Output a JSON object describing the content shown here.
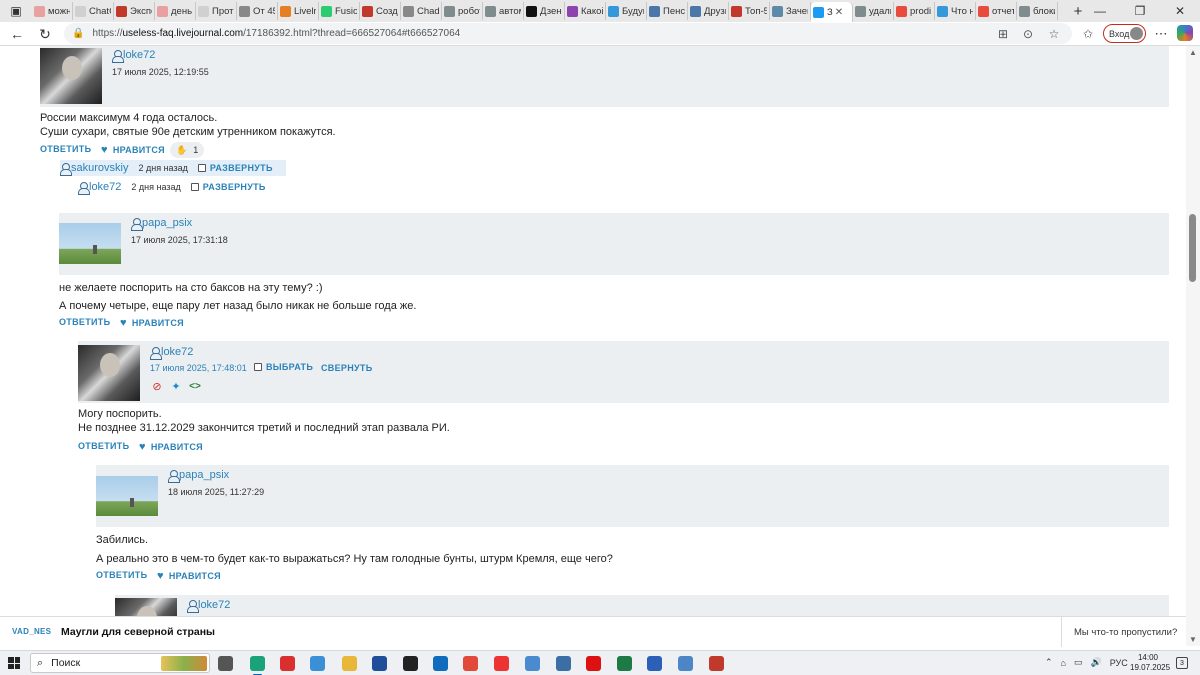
{
  "browser": {
    "tabs": [
      {
        "label": "можн",
        "color": "#e8a0a0"
      },
      {
        "label": "ChatG",
        "color": "#d0d0d0"
      },
      {
        "label": "Экспе",
        "color": "#c0392b"
      },
      {
        "label": "день",
        "color": "#e8a0a0"
      },
      {
        "label": "Прот",
        "color": "#d0d0d0"
      },
      {
        "label": "От 45",
        "color": "#888888"
      },
      {
        "label": "Livelr",
        "color": "#e67e22"
      },
      {
        "label": "Fusion",
        "color": "#2ecc71"
      },
      {
        "label": "Созда",
        "color": "#c0392b"
      },
      {
        "label": "Chad",
        "color": "#888888"
      },
      {
        "label": "робот",
        "color": "#7f8c8d"
      },
      {
        "label": "автом",
        "color": "#7f8c8d"
      },
      {
        "label": "Дзен-",
        "color": "#111111"
      },
      {
        "label": "Какой",
        "color": "#8e44ad"
      },
      {
        "label": "Будуц",
        "color": "#3498db"
      },
      {
        "label": "Пенсі",
        "color": "#4a76a8"
      },
      {
        "label": "Друзь",
        "color": "#4a76a8"
      },
      {
        "label": "Топ-5",
        "color": "#c0392b"
      },
      {
        "label": "Зачем",
        "color": "#5d8aa8"
      },
      {
        "label": "З",
        "color": "#1d9bf0",
        "active": true
      },
      {
        "label": "удали",
        "color": "#7f8c8d"
      },
      {
        "label": "prodi",
        "color": "#e74c3c"
      },
      {
        "label": "Что н",
        "color": "#3498db"
      },
      {
        "label": "отчет",
        "color": "#e74c3c"
      },
      {
        "label": "блоки",
        "color": "#7f8c8d"
      }
    ],
    "url_prefix": "https://",
    "url_host": "useless-faq.livejournal.com",
    "url_path": "/17186392.html?thread=666527064#t666527064",
    "login_label": "Вход"
  },
  "comments": [
    {
      "user": "loke72",
      "date": "17 июля 2025, 12:19:55",
      "lines": [
        "России максимум 4 года осталось.",
        "Суши сухари, святые 90е детским утренником покажутся."
      ],
      "reply_label": "ОТВЕТИТЬ",
      "like_label": "НРАВИТСЯ",
      "likes": "1"
    },
    {
      "user": "papa_psix",
      "date": "17 июля 2025, 17:31:18",
      "lines": [
        "не желаете поспорить на сто баксов на эту тему? :)",
        "А почему четыре, еще пару лет назад было никак не больше года же."
      ],
      "reply_label": "ОТВЕТИТЬ",
      "like_label": "НРАВИТСЯ"
    },
    {
      "user": "loke72",
      "date": "17 июля 2025, 17:48:01",
      "select_label": "ВЫБРАТЬ",
      "collapse_label": "СВЕРНУТЬ",
      "lines": [
        "Могу поспорить.",
        "Не позднее 31.12.2029 закончится третий и последний этап развала РИ."
      ],
      "reply_label": "ОТВЕТИТЬ",
      "like_label": "НРАВИТСЯ"
    },
    {
      "user": "papa_psix",
      "date": "18 июля 2025, 11:27:29",
      "lines": [
        "Забились.",
        "А реально это в чем-то будет как-то выражаться? Ну там голодные бунты, штурм Кремля, еще чего?"
      ],
      "reply_label": "ОТВЕТИТЬ",
      "like_label": "НРАВИТСЯ"
    },
    {
      "user": "loke72"
    }
  ],
  "collapsed": [
    {
      "user": "sakurovskiy",
      "when": "2 дня назад",
      "expand_label": "РАЗВЕРНУТЬ"
    },
    {
      "user": "loke72",
      "when": "2 дня назад",
      "expand_label": "РАЗВЕРНУТЬ"
    }
  ],
  "sticky": {
    "author": "VAD_NES",
    "title": "Маугли для северной страны",
    "missed": "Мы что-то пропустили?"
  },
  "taskbar": {
    "search_placeholder": "Поиск",
    "lang": "РУС",
    "time": "14:00",
    "date": "19.07.2025",
    "notif_count": "3"
  }
}
